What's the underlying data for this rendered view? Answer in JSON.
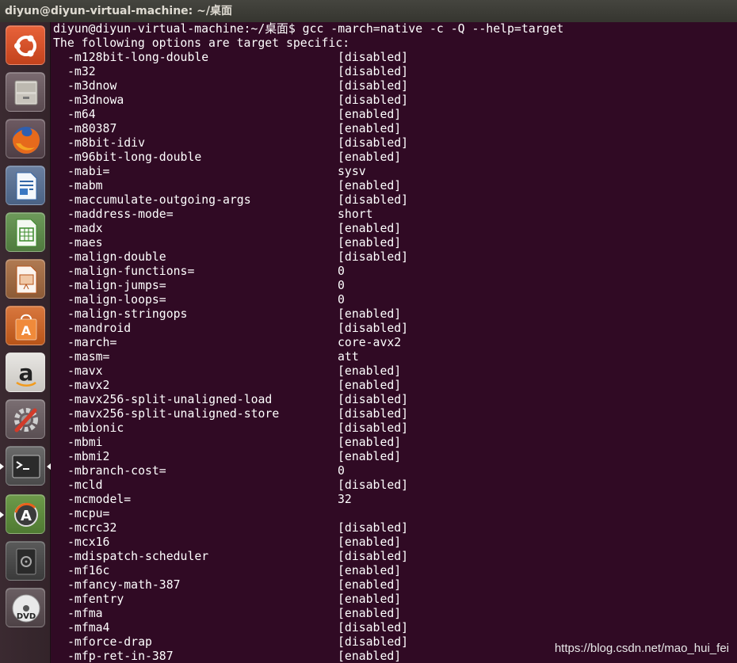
{
  "window": {
    "title": "diyun@diyun-virtual-machine: ~/桌面"
  },
  "launcher": {
    "items": [
      {
        "name": "dash-home-button"
      },
      {
        "name": "files-button"
      },
      {
        "name": "firefox-button"
      },
      {
        "name": "libreoffice-writer-button"
      },
      {
        "name": "libreoffice-calc-button"
      },
      {
        "name": "libreoffice-impress-button"
      },
      {
        "name": "ubuntu-software-center-button"
      },
      {
        "name": "amazon-button"
      },
      {
        "name": "system-settings-button"
      },
      {
        "name": "terminal-button"
      },
      {
        "name": "software-updater-button"
      },
      {
        "name": "disk-button"
      },
      {
        "name": "dvd-button"
      }
    ]
  },
  "terminal": {
    "prompt": "diyun@diyun-virtual-machine:~/桌面$ gcc -march=native -c -Q --help=target",
    "header": "The following options are target specific:",
    "options": [
      {
        "name": "-m128bit-long-double",
        "value": "[disabled]"
      },
      {
        "name": "-m32",
        "value": "[disabled]"
      },
      {
        "name": "-m3dnow",
        "value": "[disabled]"
      },
      {
        "name": "-m3dnowa",
        "value": "[disabled]"
      },
      {
        "name": "-m64",
        "value": "[enabled]"
      },
      {
        "name": "-m80387",
        "value": "[enabled]"
      },
      {
        "name": "-m8bit-idiv",
        "value": "[disabled]"
      },
      {
        "name": "-m96bit-long-double",
        "value": "[enabled]"
      },
      {
        "name": "-mabi=",
        "value": "sysv"
      },
      {
        "name": "-mabm",
        "value": "[enabled]"
      },
      {
        "name": "-maccumulate-outgoing-args",
        "value": "[disabled]"
      },
      {
        "name": "-maddress-mode=",
        "value": "short"
      },
      {
        "name": "-madx",
        "value": "[enabled]"
      },
      {
        "name": "-maes",
        "value": "[enabled]"
      },
      {
        "name": "-malign-double",
        "value": "[disabled]"
      },
      {
        "name": "-malign-functions=",
        "value": "0"
      },
      {
        "name": "-malign-jumps=",
        "value": "0"
      },
      {
        "name": "-malign-loops=",
        "value": "0"
      },
      {
        "name": "-malign-stringops",
        "value": "[enabled]"
      },
      {
        "name": "-mandroid",
        "value": "[disabled]"
      },
      {
        "name": "-march=",
        "value": "core-avx2"
      },
      {
        "name": "-masm=",
        "value": "att"
      },
      {
        "name": "-mavx",
        "value": "[enabled]"
      },
      {
        "name": "-mavx2",
        "value": "[enabled]"
      },
      {
        "name": "-mavx256-split-unaligned-load",
        "value": "[disabled]"
      },
      {
        "name": "-mavx256-split-unaligned-store",
        "value": "[disabled]"
      },
      {
        "name": "-mbionic",
        "value": "[disabled]"
      },
      {
        "name": "-mbmi",
        "value": "[enabled]"
      },
      {
        "name": "-mbmi2",
        "value": "[enabled]"
      },
      {
        "name": "-mbranch-cost=",
        "value": "0"
      },
      {
        "name": "-mcld",
        "value": "[disabled]"
      },
      {
        "name": "-mcmodel=",
        "value": "32"
      },
      {
        "name": "-mcpu=",
        "value": ""
      },
      {
        "name": "-mcrc32",
        "value": "[disabled]"
      },
      {
        "name": "-mcx16",
        "value": "[enabled]"
      },
      {
        "name": "-mdispatch-scheduler",
        "value": "[disabled]"
      },
      {
        "name": "-mf16c",
        "value": "[enabled]"
      },
      {
        "name": "-mfancy-math-387",
        "value": "[enabled]"
      },
      {
        "name": "-mfentry",
        "value": "[enabled]"
      },
      {
        "name": "-mfma",
        "value": "[enabled]"
      },
      {
        "name": "-mfma4",
        "value": "[disabled]"
      },
      {
        "name": "-mforce-drap",
        "value": "[disabled]"
      },
      {
        "name": "-mfp-ret-in-387",
        "value": "[enabled]"
      }
    ]
  },
  "watermark": "https://blog.csdn.net/mao_hui_fei",
  "colors": {
    "terminal_bg": "#300a24",
    "text": "#ffffff",
    "titlebar": "#3c3b37"
  }
}
